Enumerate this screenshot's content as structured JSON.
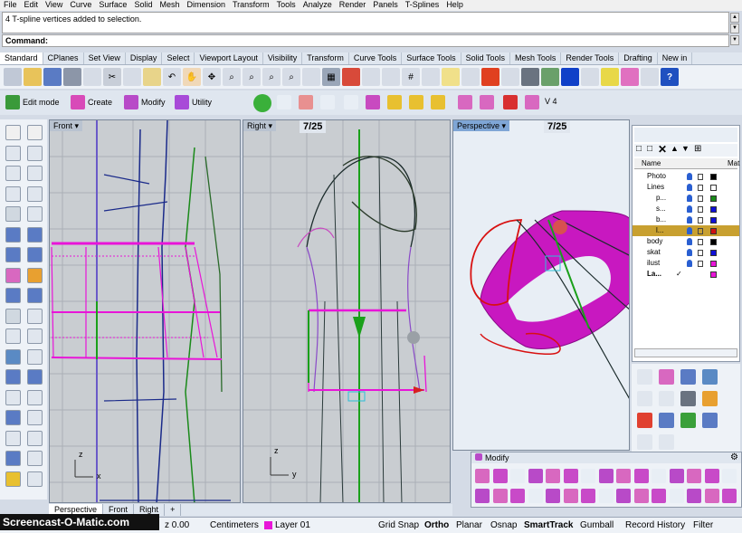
{
  "menubar": [
    "File",
    "Edit",
    "View",
    "Curve",
    "Surface",
    "Solid",
    "Mesh",
    "Dimension",
    "Transform",
    "Tools",
    "Analyze",
    "Render",
    "Panels",
    "T-Splines",
    "Help"
  ],
  "command": {
    "history": "4 T-spline vertices added to selection.",
    "prompt": "Command:"
  },
  "tabs": [
    {
      "label": "Standard",
      "active": true
    },
    {
      "label": "CPlanes"
    },
    {
      "label": "Set View"
    },
    {
      "label": "Display"
    },
    {
      "label": "Select"
    },
    {
      "label": "Viewport Layout"
    },
    {
      "label": "Visibility"
    },
    {
      "label": "Transform"
    },
    {
      "label": "Curve Tools"
    },
    {
      "label": "Surface Tools"
    },
    {
      "label": "Solid Tools"
    },
    {
      "label": "Mesh Tools"
    },
    {
      "label": "Render Tools"
    },
    {
      "label": "Drafting"
    },
    {
      "label": "New in"
    }
  ],
  "tsplines": {
    "edit_mode": "Edit mode",
    "create": "Create",
    "modify": "Modify",
    "utility": "Utility",
    "version": "V 4"
  },
  "viewports": {
    "front": {
      "title": "Front",
      "axis_x": "x",
      "axis_z": "z"
    },
    "right": {
      "title": "Right",
      "badge": "7/25",
      "axis_y": "y",
      "axis_z": "z"
    },
    "perspective": {
      "title": "Perspective",
      "badge": "7/25"
    }
  },
  "layers": {
    "headers": {
      "name": "Name",
      "material": "Mat"
    },
    "rows": [
      {
        "name": "Photo",
        "indent": 0,
        "color": "#000000"
      },
      {
        "name": "Lines",
        "indent": 0,
        "color": "#ffffff"
      },
      {
        "name": "p...",
        "indent": 1,
        "color": "#1a8a1a"
      },
      {
        "name": "s...",
        "indent": 1,
        "color": "#1010d8"
      },
      {
        "name": "b...",
        "indent": 1,
        "color": "#1010d8"
      },
      {
        "name": "l...",
        "indent": 1,
        "color": "#d01010",
        "selected": true
      },
      {
        "name": "body",
        "indent": 0,
        "color": "#000000"
      },
      {
        "name": "skat",
        "indent": 0,
        "color": "#1010d8"
      },
      {
        "name": "ilust",
        "indent": 0,
        "color": "#e815d8"
      },
      {
        "name": "La...",
        "indent": 0,
        "color": "#e815d8",
        "current": true
      }
    ]
  },
  "modify_panel": {
    "title": "Modify"
  },
  "viewport_tabs": [
    "Perspective",
    "Front",
    "Right"
  ],
  "status": {
    "z": "z 0.00",
    "units": "Centimeters",
    "layer": "Layer 01",
    "grid_snap": "Grid Snap",
    "ortho": "Ortho",
    "planar": "Planar",
    "osnap": "Osnap",
    "smarttrack": "SmartTrack",
    "gumball": "Gumball",
    "record_history": "Record History",
    "filter": "Filter"
  },
  "watermark": "Screencast-O-Matic.com",
  "colors": {
    "magenta": "#e815d8",
    "accent_green": "#1aa01a",
    "toolbar_bg": "#eef2f7",
    "viewport_bg": "#c9cdd1"
  }
}
